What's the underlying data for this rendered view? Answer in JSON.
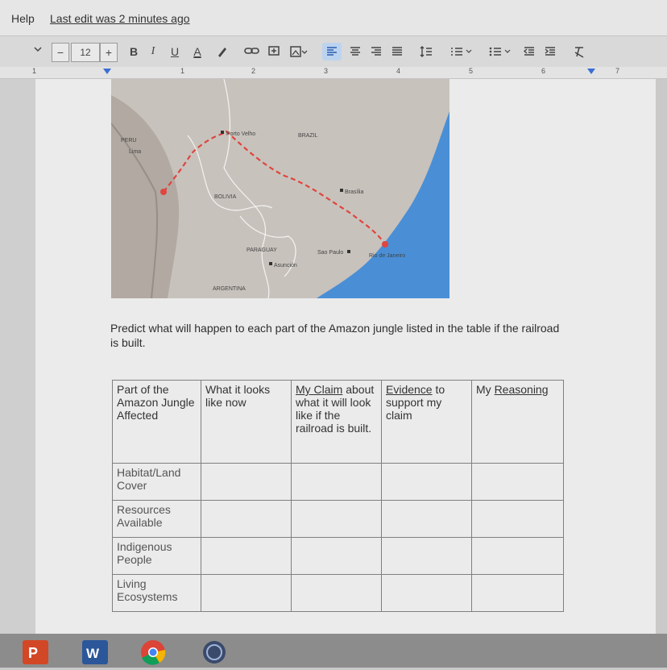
{
  "menubar": {
    "help": "Help",
    "last_edit": "Last edit was 2 minutes ago"
  },
  "toolbar": {
    "minus": "−",
    "font_size": "12",
    "plus": "+",
    "bold": "B",
    "italic": "I",
    "underline": "U",
    "text_color": "A"
  },
  "ruler": {
    "numbers": [
      "1",
      "1",
      "2",
      "3",
      "4",
      "5",
      "6",
      "7"
    ]
  },
  "map": {
    "labels": {
      "porto_velho": "Porto Velho",
      "brazil": "BRAZIL",
      "peru": "PERU",
      "lima": "Lima",
      "brasilia": "Brasília",
      "bolivia": "BOLIVIA",
      "paraguay": "PARAGUAY",
      "asuncion": "Asunción",
      "sao_paulo": "Sao Paulo",
      "rio": "Rio de Janeiro",
      "argentina": "ARGENTINA"
    }
  },
  "prompt_text": "Predict what will happen to each part of the Amazon jungle listed in the table if the railroad is built.",
  "table": {
    "col1": "Part of the Amazon Jungle Affected",
    "col2": "What it looks like now",
    "col3_link": "My Claim",
    "col3_rest": " about what it will look like if the railroad is built.",
    "col4_link": "Evidence",
    "col4_rest": " to support my claim",
    "col5_pre": "My ",
    "col5_link": "Reasoning",
    "rows": [
      "Habitat/Land Cover",
      "Resources Available",
      "Indigenous People",
      "Living Ecosystems"
    ]
  },
  "colors": {
    "route": "#e0453f",
    "ocean": "#4a8fd6",
    "land": "#c8c2bc",
    "active_align": "#bcd3ef"
  }
}
